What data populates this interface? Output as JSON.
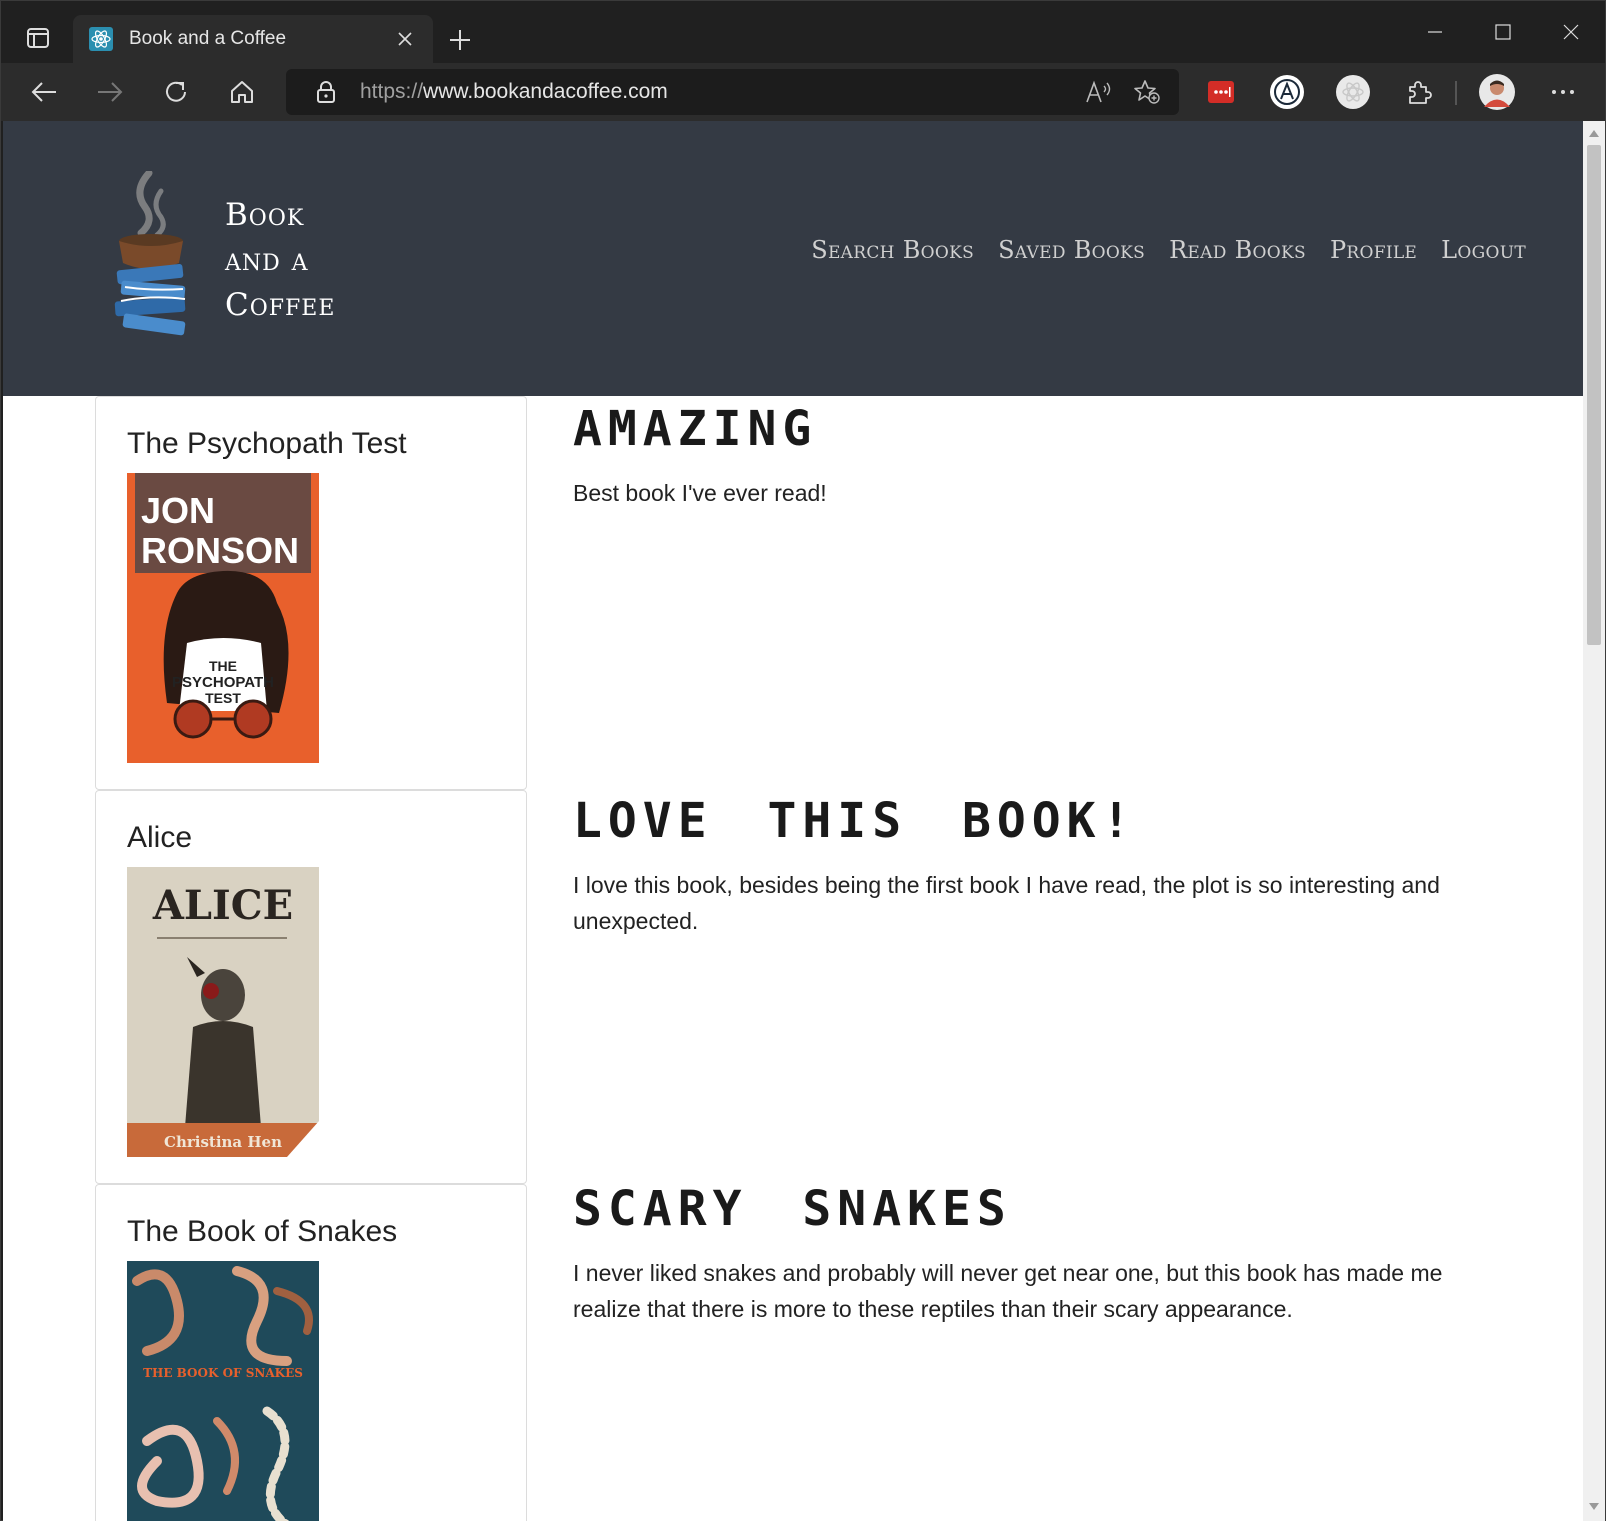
{
  "browser": {
    "tab_title": "Book and a Coffee",
    "url_scheme": "https://",
    "url_host": "www.bookandacoffee.com"
  },
  "site": {
    "brand_line1": "Book",
    "brand_line2": "and a",
    "brand_line3": "Coffee",
    "nav": {
      "search": "Search Books",
      "saved": "Saved Books",
      "read": "Read Books",
      "profile": "Profile",
      "logout": "Logout"
    }
  },
  "books": [
    {
      "title": "The Psychopath Test",
      "cover": {
        "author_line1": "JON",
        "author_line2": "RONSON",
        "title_line1": "THE",
        "title_line2": "PSYCHOPATH",
        "title_line3": "TEST",
        "bg": "#e8602c"
      },
      "review_title": "Amazing",
      "review_body": "Best book I've ever read!"
    },
    {
      "title": "Alice",
      "cover": {
        "title": "ALICE",
        "author": "Christina Hen",
        "bg": "#d9d2c2"
      },
      "review_title": "Love this book!",
      "review_body": "I love this book, besides being the first book I have read, the plot is so interesting and unexpected."
    },
    {
      "title": "The Book of Snakes",
      "cover": {
        "title": "THE BOOK OF SNAKES",
        "bg": "#1f4a5a"
      },
      "review_title": "Scary snakes",
      "review_body": "I never liked snakes and probably will never get near one, but this book has made me realize that there is more to these reptiles than their scary appearance."
    }
  ],
  "colors": {
    "header_bg": "#343a44",
    "chrome_bg": "#202020",
    "toolbar_bg": "#2c2c2c"
  }
}
